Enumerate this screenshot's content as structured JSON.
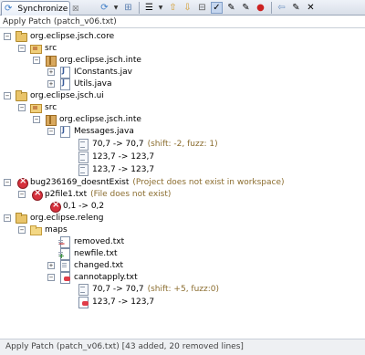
{
  "view": {
    "tab_label": "Synchronize",
    "tab_close": "☒"
  },
  "toolbar": {
    "icons": [
      "sync-icon",
      "dropdown",
      "pin-icon",
      "menu-icon",
      "up-arrow-icon",
      "down-arrow-icon",
      "collapse-icon",
      "tool-icon",
      "wrench-icon",
      "stop-icon",
      "remove-icon",
      "back-icon",
      "pin-editor-icon"
    ]
  },
  "header": {
    "title": "Apply Patch (patch_v06.txt)"
  },
  "tree": {
    "p1": "org.eclipse.jsch.core",
    "p1_src": "src",
    "p1_pkg": "org.eclipse.jsch.inte",
    "p1_f1": "IConstants.jav",
    "p1_f2": "Utils.java",
    "p2": "org.eclipse.jsch.ui",
    "p2_src": "src",
    "p2_pkg": "org.eclipse.jsch.inte",
    "p2_f1": "Messages.java",
    "p2_h1": "70,7 -> 70,7",
    "p2_h1_note": "(shift: -2, fuzz: 1)",
    "p2_h2": "123,7 -> 123,7",
    "p2_h3": "123,7 -> 123,7",
    "p3": "bug236169_doesntExist",
    "p3_note": "(Project does not exist in workspace)",
    "p3_f1": "p2file1.txt",
    "p3_f1_note": "(File does not exist)",
    "p3_h1": "0,1 -> 0,2",
    "p4": "org.eclipse.releng",
    "p4_maps": "maps",
    "p4_f1": "removed.txt",
    "p4_f2": "newfile.txt",
    "p4_f3": "changed.txt",
    "p4_f4": "cannotapply.txt",
    "p4_h1": "70,7 -> 70,7",
    "p4_h1_note": "(shift: +5, fuzz:0)",
    "p4_h2": "123,7 -> 123,7"
  },
  "status": {
    "text": "Apply Patch (patch_v06.txt) [43 added, 20 removed lines]"
  },
  "colors": {
    "note": "#8b6d2f",
    "error": "#d6303c",
    "muted": "#6e6e6e"
  }
}
